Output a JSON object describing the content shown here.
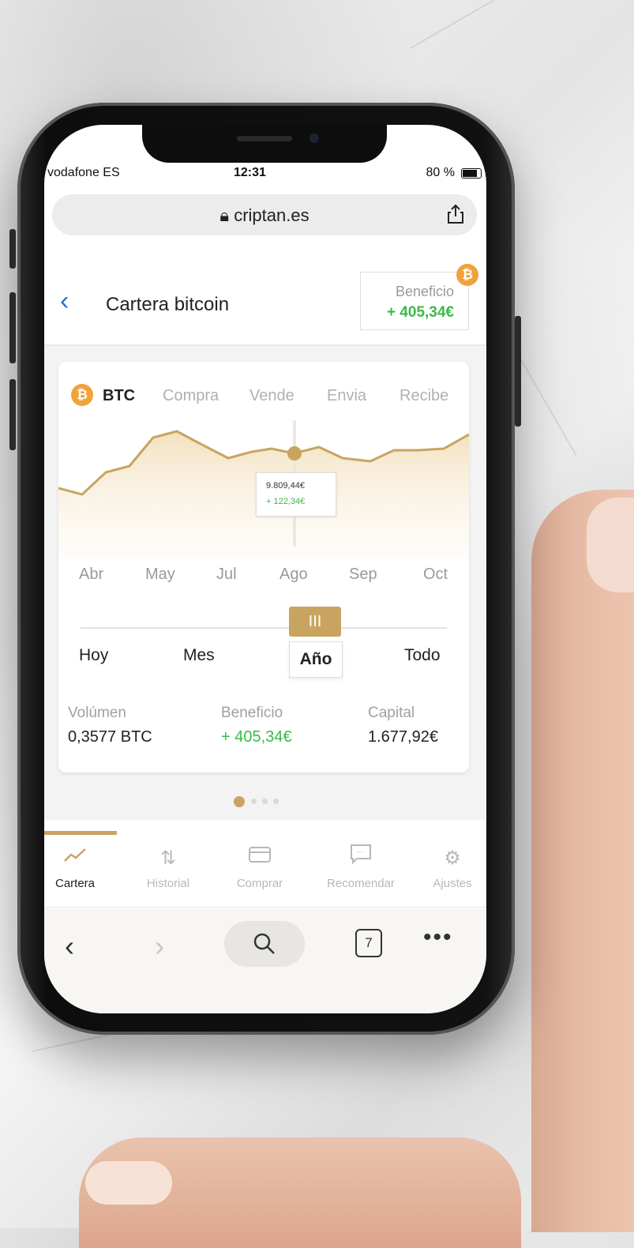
{
  "status": {
    "carrier": "vodafone ES",
    "time": "12:31",
    "battery": "80 %"
  },
  "browser": {
    "url": "criptan.es",
    "tabs_count": "7"
  },
  "header": {
    "title": "Cartera bitcoin",
    "benefit_label": "Beneficio",
    "benefit_value": "+ 405,34€",
    "badge": "₿"
  },
  "card": {
    "coin": "BTC",
    "tabs": [
      "BTC",
      "Compra",
      "Vende",
      "Envia",
      "Recibe"
    ],
    "tooltip": {
      "price": "9.809,44€",
      "change": "+ 122,34€"
    },
    "months": [
      "Abr",
      "May",
      "Jul",
      "Ago",
      "Sep",
      "Oct"
    ],
    "periods": [
      "Hoy",
      "Mes",
      "Año",
      "Todo"
    ],
    "selected_period": "Año",
    "handle_glyph": "III",
    "stats": [
      {
        "label": "Volúmen",
        "value": "0,3577 BTC"
      },
      {
        "label": "Beneficio",
        "value": "+ 405,34€"
      },
      {
        "label": "Capital",
        "value": "1.677,92€"
      }
    ]
  },
  "pager": {
    "total": 4,
    "active": 0
  },
  "nav": [
    {
      "label": "Cartera",
      "icon": "chart-line-icon",
      "active": true
    },
    {
      "label": "Historial",
      "icon": "sort-arrows-icon",
      "active": false
    },
    {
      "label": "Comprar",
      "icon": "card-icon",
      "active": false
    },
    {
      "label": "Recomendar",
      "icon": "message-icon",
      "active": false
    },
    {
      "label": "Ajustes",
      "icon": "gear-icon",
      "active": false
    }
  ],
  "colors": {
    "accent": "#c9a460",
    "positive": "#3cb94a",
    "bitcoin": "#f2a23a",
    "link": "#2d6cdf"
  }
}
